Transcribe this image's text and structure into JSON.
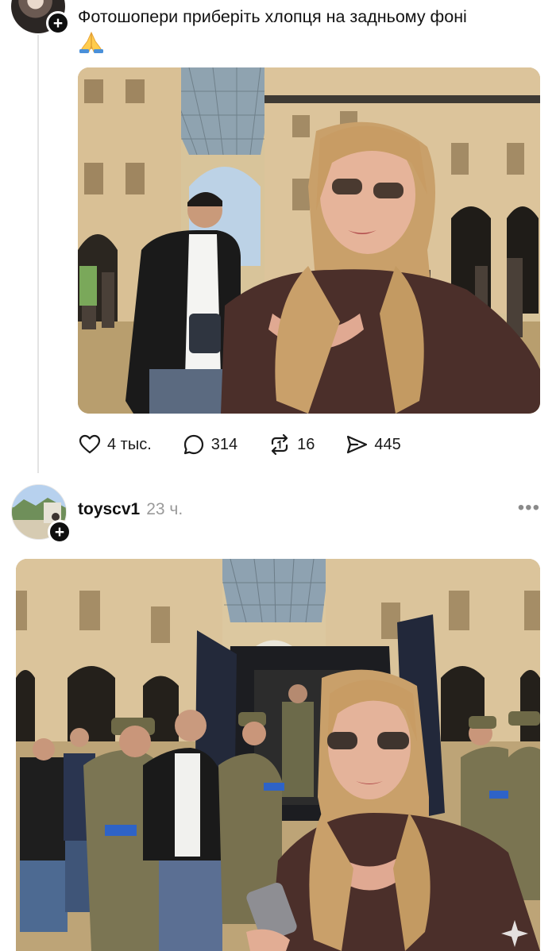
{
  "post1": {
    "text": "Фотошопери приберіть хлопця на задньому фоні",
    "emoji": "🙏",
    "stats": {
      "likes": "4 тыс.",
      "comments": "314",
      "reposts": "16",
      "shares": "445"
    }
  },
  "post2": {
    "username": "toyscv1",
    "time": "23 ч.",
    "more_label": "•••"
  },
  "icons": {
    "like": "heart-icon",
    "comment": "comment-bubble-icon",
    "repost": "repost-icon",
    "share": "send-icon",
    "follow": "plus-icon"
  },
  "colors": {
    "text": "#121212",
    "muted": "#9a9a9a",
    "thread_line": "#e3e3e3"
  }
}
